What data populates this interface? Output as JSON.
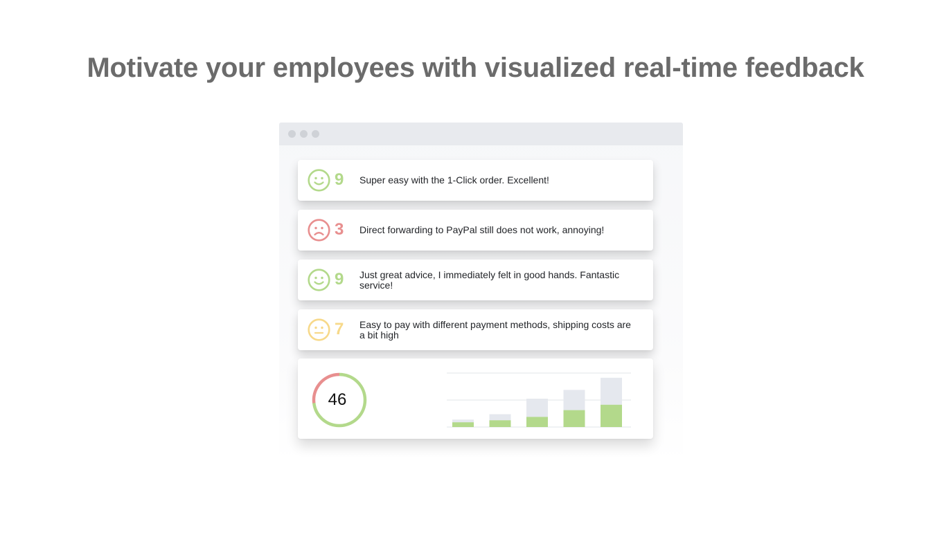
{
  "headline": "Motivate your employees with visualized real-time feedback",
  "colors": {
    "positive": "#b3d98b",
    "negative": "#e88f8f",
    "neutral": "#f7d98a",
    "bar_total": "#e5e8ee",
    "grid": "#e2e4e8"
  },
  "feedback": [
    {
      "score": "9",
      "mood": "smile-icon",
      "tone": "positive",
      "text": "Super easy with the 1-Click order. Excellent!"
    },
    {
      "score": "3",
      "mood": "frown-icon",
      "tone": "negative",
      "text": "Direct forwarding to PayPal still does not work, annoying!"
    },
    {
      "score": "9",
      "mood": "smile-icon",
      "tone": "positive",
      "text": "Just great advice, I immediately felt in good hands. Fantastic service!"
    },
    {
      "score": "7",
      "mood": "neutral-face-icon",
      "tone": "neutral",
      "text": "Easy to pay with different payment methods, shipping costs are a bit high"
    }
  ],
  "summary": {
    "score": "46",
    "gauge": {
      "negative_fraction": 0.27,
      "positive_fraction": 0.73
    }
  },
  "chart_data": {
    "type": "bar",
    "categories": [
      "",
      "",
      "",
      "",
      ""
    ],
    "series": [
      {
        "values": [
          11,
          19,
          42,
          55,
          73
        ]
      },
      {
        "values": [
          7,
          10,
          15,
          25,
          33
        ]
      }
    ],
    "ylim": [
      0,
      80
    ],
    "grid": true
  }
}
